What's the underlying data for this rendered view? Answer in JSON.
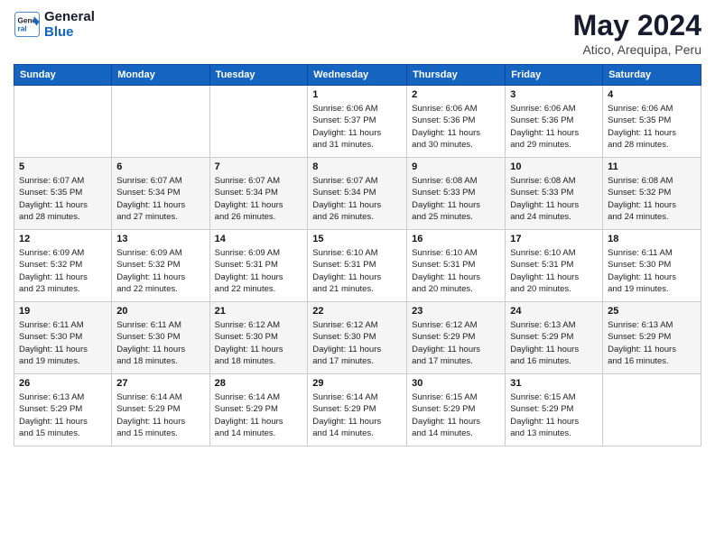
{
  "header": {
    "logo_line1": "General",
    "logo_line2": "Blue",
    "month_year": "May 2024",
    "location": "Atico, Arequipa, Peru"
  },
  "weekdays": [
    "Sunday",
    "Monday",
    "Tuesday",
    "Wednesday",
    "Thursday",
    "Friday",
    "Saturday"
  ],
  "weeks": [
    [
      {
        "day": "",
        "info": ""
      },
      {
        "day": "",
        "info": ""
      },
      {
        "day": "",
        "info": ""
      },
      {
        "day": "1",
        "info": "Sunrise: 6:06 AM\nSunset: 5:37 PM\nDaylight: 11 hours\nand 31 minutes."
      },
      {
        "day": "2",
        "info": "Sunrise: 6:06 AM\nSunset: 5:36 PM\nDaylight: 11 hours\nand 30 minutes."
      },
      {
        "day": "3",
        "info": "Sunrise: 6:06 AM\nSunset: 5:36 PM\nDaylight: 11 hours\nand 29 minutes."
      },
      {
        "day": "4",
        "info": "Sunrise: 6:06 AM\nSunset: 5:35 PM\nDaylight: 11 hours\nand 28 minutes."
      }
    ],
    [
      {
        "day": "5",
        "info": "Sunrise: 6:07 AM\nSunset: 5:35 PM\nDaylight: 11 hours\nand 28 minutes."
      },
      {
        "day": "6",
        "info": "Sunrise: 6:07 AM\nSunset: 5:34 PM\nDaylight: 11 hours\nand 27 minutes."
      },
      {
        "day": "7",
        "info": "Sunrise: 6:07 AM\nSunset: 5:34 PM\nDaylight: 11 hours\nand 26 minutes."
      },
      {
        "day": "8",
        "info": "Sunrise: 6:07 AM\nSunset: 5:34 PM\nDaylight: 11 hours\nand 26 minutes."
      },
      {
        "day": "9",
        "info": "Sunrise: 6:08 AM\nSunset: 5:33 PM\nDaylight: 11 hours\nand 25 minutes."
      },
      {
        "day": "10",
        "info": "Sunrise: 6:08 AM\nSunset: 5:33 PM\nDaylight: 11 hours\nand 24 minutes."
      },
      {
        "day": "11",
        "info": "Sunrise: 6:08 AM\nSunset: 5:32 PM\nDaylight: 11 hours\nand 24 minutes."
      }
    ],
    [
      {
        "day": "12",
        "info": "Sunrise: 6:09 AM\nSunset: 5:32 PM\nDaylight: 11 hours\nand 23 minutes."
      },
      {
        "day": "13",
        "info": "Sunrise: 6:09 AM\nSunset: 5:32 PM\nDaylight: 11 hours\nand 22 minutes."
      },
      {
        "day": "14",
        "info": "Sunrise: 6:09 AM\nSunset: 5:31 PM\nDaylight: 11 hours\nand 22 minutes."
      },
      {
        "day": "15",
        "info": "Sunrise: 6:10 AM\nSunset: 5:31 PM\nDaylight: 11 hours\nand 21 minutes."
      },
      {
        "day": "16",
        "info": "Sunrise: 6:10 AM\nSunset: 5:31 PM\nDaylight: 11 hours\nand 20 minutes."
      },
      {
        "day": "17",
        "info": "Sunrise: 6:10 AM\nSunset: 5:31 PM\nDaylight: 11 hours\nand 20 minutes."
      },
      {
        "day": "18",
        "info": "Sunrise: 6:11 AM\nSunset: 5:30 PM\nDaylight: 11 hours\nand 19 minutes."
      }
    ],
    [
      {
        "day": "19",
        "info": "Sunrise: 6:11 AM\nSunset: 5:30 PM\nDaylight: 11 hours\nand 19 minutes."
      },
      {
        "day": "20",
        "info": "Sunrise: 6:11 AM\nSunset: 5:30 PM\nDaylight: 11 hours\nand 18 minutes."
      },
      {
        "day": "21",
        "info": "Sunrise: 6:12 AM\nSunset: 5:30 PM\nDaylight: 11 hours\nand 18 minutes."
      },
      {
        "day": "22",
        "info": "Sunrise: 6:12 AM\nSunset: 5:30 PM\nDaylight: 11 hours\nand 17 minutes."
      },
      {
        "day": "23",
        "info": "Sunrise: 6:12 AM\nSunset: 5:29 PM\nDaylight: 11 hours\nand 17 minutes."
      },
      {
        "day": "24",
        "info": "Sunrise: 6:13 AM\nSunset: 5:29 PM\nDaylight: 11 hours\nand 16 minutes."
      },
      {
        "day": "25",
        "info": "Sunrise: 6:13 AM\nSunset: 5:29 PM\nDaylight: 11 hours\nand 16 minutes."
      }
    ],
    [
      {
        "day": "26",
        "info": "Sunrise: 6:13 AM\nSunset: 5:29 PM\nDaylight: 11 hours\nand 15 minutes."
      },
      {
        "day": "27",
        "info": "Sunrise: 6:14 AM\nSunset: 5:29 PM\nDaylight: 11 hours\nand 15 minutes."
      },
      {
        "day": "28",
        "info": "Sunrise: 6:14 AM\nSunset: 5:29 PM\nDaylight: 11 hours\nand 14 minutes."
      },
      {
        "day": "29",
        "info": "Sunrise: 6:14 AM\nSunset: 5:29 PM\nDaylight: 11 hours\nand 14 minutes."
      },
      {
        "day": "30",
        "info": "Sunrise: 6:15 AM\nSunset: 5:29 PM\nDaylight: 11 hours\nand 14 minutes."
      },
      {
        "day": "31",
        "info": "Sunrise: 6:15 AM\nSunset: 5:29 PM\nDaylight: 11 hours\nand 13 minutes."
      },
      {
        "day": "",
        "info": ""
      }
    ]
  ]
}
